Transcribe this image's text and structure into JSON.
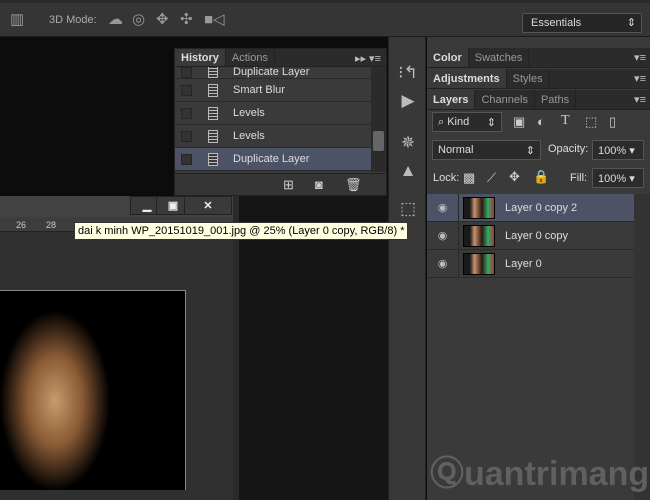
{
  "toolbar": {
    "mode_label": "3D Mode:",
    "workspace": "Essentials"
  },
  "history": {
    "tabs": [
      "History",
      "Actions"
    ],
    "items": [
      {
        "label": "Duplicate Layer",
        "selected": false
      },
      {
        "label": "Smart Blur",
        "selected": false
      },
      {
        "label": "Levels",
        "selected": false
      },
      {
        "label": "Levels",
        "selected": false
      },
      {
        "label": "Duplicate Layer",
        "selected": true
      }
    ]
  },
  "right": {
    "tabs1": [
      "Color",
      "Swatches"
    ],
    "tabs2": [
      "Adjustments",
      "Styles"
    ],
    "tabs3": [
      "Layers",
      "Channels",
      "Paths"
    ],
    "filter": "Kind",
    "blend": "Normal",
    "opacity_label": "Opacity:",
    "opacity": "100%",
    "lock_label": "Lock:",
    "fill_label": "Fill:",
    "fill": "100%",
    "layers": [
      {
        "name": "Layer 0 copy 2"
      },
      {
        "name": "Layer 0 copy"
      },
      {
        "name": "Layer 0"
      }
    ]
  },
  "document": {
    "tooltip": "dai k minh WP_20151019_001.jpg @ 25% (Layer 0 copy, RGB/8) *",
    "ruler": [
      "26",
      "28"
    ]
  },
  "watermark": "Quantrimang"
}
